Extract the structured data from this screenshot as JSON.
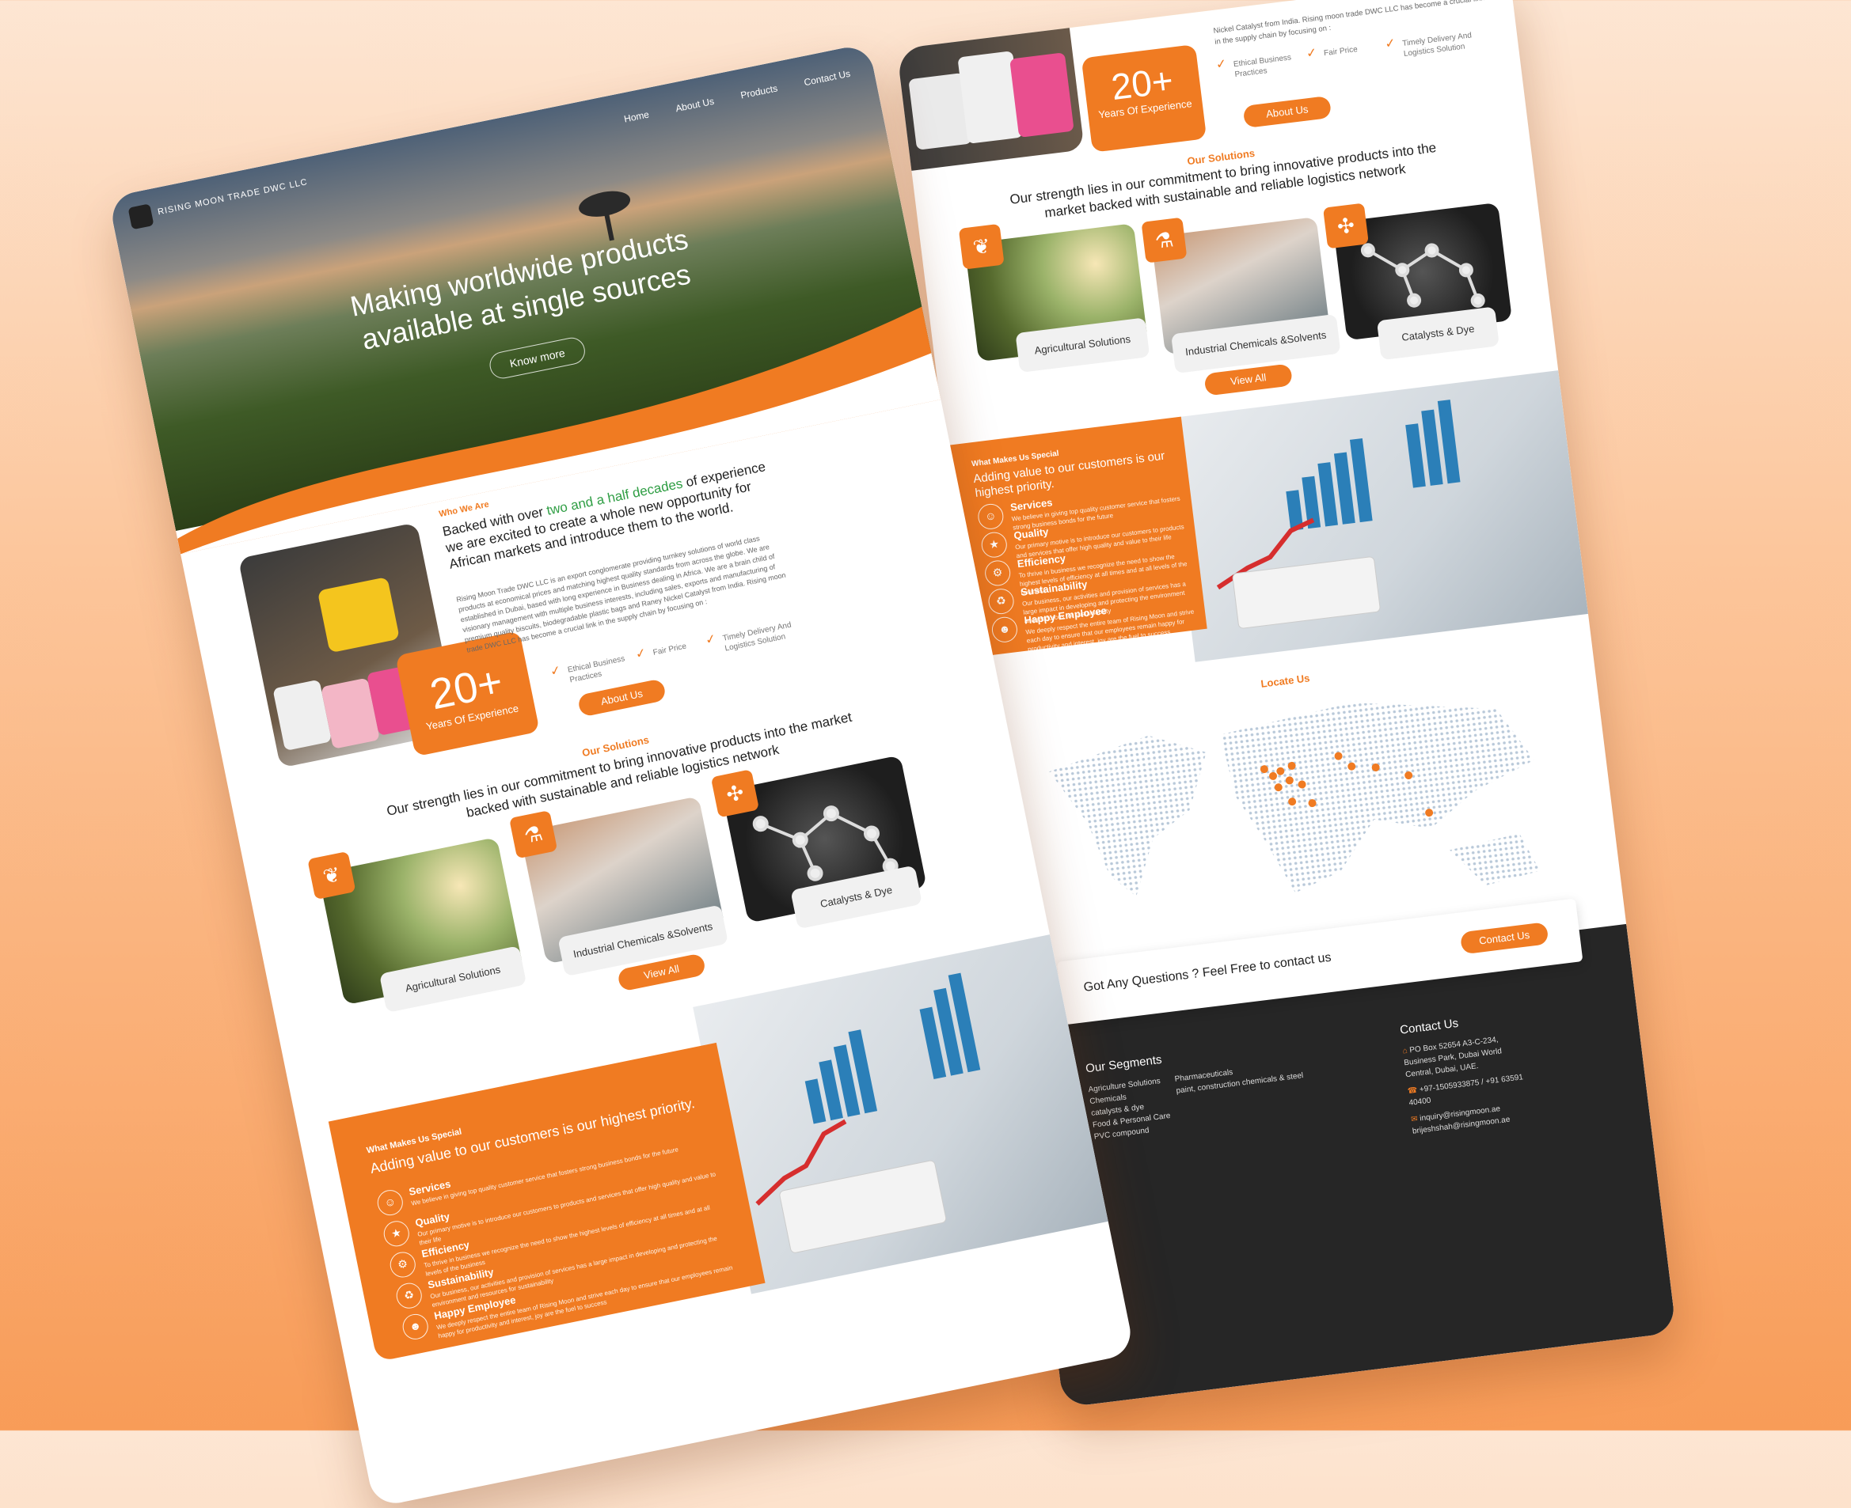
{
  "left_page": {
    "nav": {
      "brand": "RISING MOON TRADE DWC LLC",
      "items": [
        "Home",
        "About Us",
        "Products",
        "Contact Us"
      ]
    },
    "hero": {
      "title_line1": "Making worldwide products",
      "title_line2": "available at single sources",
      "cta": "Know more"
    },
    "about": {
      "kicker": "Who We Are",
      "heading_pre": "Backed with over ",
      "heading_highlight": "two and a half decades",
      "heading_post": " of experience we are excited to create a whole new opportunity for African markets and introduce them to the world.",
      "body": "Rising Moon Trade DWC LLC is an export conglomerate providing turnkey solutions of world class products at economical prices and matching highest quality standards from across the globe. We are established in Dubai, based with long experience in Business dealing in Africa. We are a brain child of visionary management with multiple business interests, including sales, exports and manufacturing of premium quality biscuits, biodegradable plastic bags and Raney Nickel Catalyst from India. Rising moon trade DWC LLC has become a crucial link in the supply chain by focusing on :",
      "exp_number": "20+",
      "exp_label": "Years Of Experience",
      "checks": [
        "Ethical Business Practices",
        "Fair Price",
        "Timely Delivery And Logistics Solution"
      ],
      "button": "About Us"
    },
    "solutions": {
      "kicker": "Our Solutions",
      "heading": "Our strength lies in our commitment to bring innovative products into the market backed with sustainable and reliable logistics network",
      "cards": [
        "Agricultural Solutions",
        "Industrial Chemicals &Solvents",
        "Catalysts & Dye"
      ],
      "button": "View All"
    },
    "special": {
      "kicker": "What Makes Us Special",
      "heading": "Adding value to our customers is our highest priority.",
      "items": [
        {
          "title": "Services",
          "desc": "We believe in giving top quality customer service that fosters strong business bonds for the future"
        },
        {
          "title": "Quality",
          "desc": "Our primary motive is to introduce our customers to products and services that offer high quality and value to their life"
        },
        {
          "title": "Efficiency",
          "desc": "To thrive in business we recognize the need to show the highest levels of efficiency at all times and at all levels of the business"
        },
        {
          "title": "Sustainability",
          "desc": "Our business, our activities and provision of services has a large impact in developing and protecting the environment and resources for sustainability"
        },
        {
          "title": "Happy Employee",
          "desc": "We deeply respect the entire team of Rising Moon and strive each day to ensure that our employees remain happy for productivity and interest, joy are the fuel to success"
        }
      ]
    }
  },
  "right_page": {
    "about_snippet": "Nickel Catalyst from India. Rising moon trade DWC LLC has become a crucial link in the supply chain by focusing on :",
    "exp_number": "20+",
    "exp_label": "Years Of Experience",
    "checks": [
      "Ethical Business Practices",
      "Fair Price",
      "Timely Delivery And Logistics Solution"
    ],
    "about_button": "About Us",
    "solutions": {
      "kicker": "Our Solutions",
      "heading": "Our strength lies in our commitment to bring innovative products into the market backed with sustainable and reliable logistics network",
      "cards": [
        "Agricultural Solutions",
        "Industrial Chemicals &Solvents",
        "Catalysts & Dye"
      ],
      "button": "View All"
    },
    "special": {
      "kicker": "What Makes Us Special",
      "heading": "Adding value to our customers is our highest priority.",
      "items": [
        {
          "title": "Services",
          "desc": "We believe in giving top quality customer service that fosters strong business bonds for the future"
        },
        {
          "title": "Quality",
          "desc": "Our primary motive is to introduce our customers to products and services that offer high quality and value to their life"
        },
        {
          "title": "Efficiency",
          "desc": "To thrive in business we recognize the need to show the highest levels of efficiency at all times and at all levels of the business"
        },
        {
          "title": "Sustainability",
          "desc": "Our business, our activities and provision of services has a large impact in developing and protecting the environment and resources for sustainability"
        },
        {
          "title": "Happy Employee",
          "desc": "We deeply respect the entire team of Rising Moon and strive each day to ensure that our employees remain happy for productivity and interest, joy are the fuel to success"
        }
      ]
    },
    "locate": {
      "kicker": "Locate Us"
    },
    "cta": {
      "text": "Got Any Questions ? Feel Free to contact us",
      "button": "Contact Us"
    },
    "footer": {
      "segments_title": "Our Segments",
      "segments_col1": [
        "Agriculture Solutions",
        "Chemicals",
        "catalysts & dye",
        "Food & Personal Care",
        "PVC compound"
      ],
      "segments_col2": [
        "Pharmaceuticals",
        "paint, construction chemicals & steel"
      ],
      "contact_title": "Contact Us",
      "address": "PO Box 52654 A3-C-234, Business Park, Dubai World Central, Dubai, UAE.",
      "phone": "+97-1505933875 / +91 63591 40400",
      "email1": "inquiry@risingmoon.ae",
      "email2": "brijeshshah@risingmoon.ae"
    }
  },
  "colors": {
    "accent": "#f07b22",
    "dark": "#262626",
    "bg_top": "#fde6d3",
    "bg_bottom": "#f89c58"
  }
}
